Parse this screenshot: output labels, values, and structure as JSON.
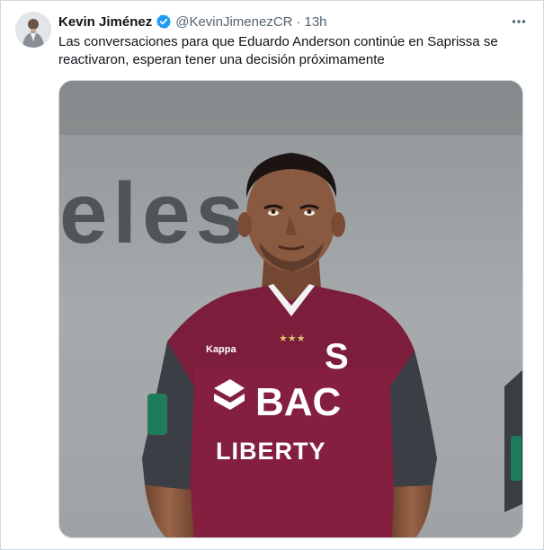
{
  "tweet": {
    "author_name": "Kevin Jiménez",
    "author_handle": "@KevinJimenezCR",
    "separator": "·",
    "time": "13h",
    "text": "Las conversaciones para que Eduardo Anderson continúe en Saprissa se reactivaron, esperan tener una decisión próximamente",
    "verified_icon": "verified-badge-icon",
    "more_icon": "more-options-icon",
    "colors": {
      "verified": "#1d9bf0",
      "muted_text": "#536471",
      "jersey": "#7c1d3b"
    }
  },
  "photo": {
    "background_text": "eles",
    "jersey_crest": "S",
    "jersey_sponsor_main": "BAC",
    "jersey_sponsor_secondary": "LIBERTY",
    "jersey_brand": "Kappa"
  }
}
